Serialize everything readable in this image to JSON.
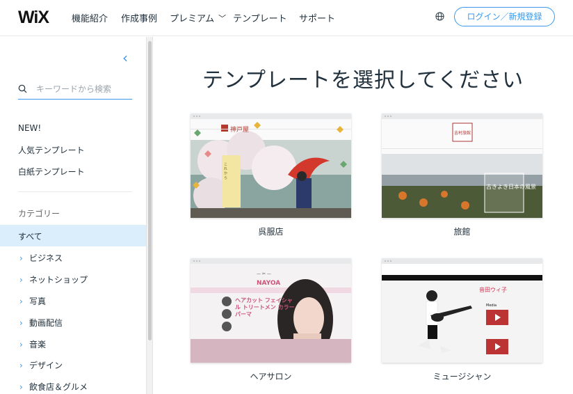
{
  "header": {
    "logo": "WiX",
    "nav": [
      "機能紹介",
      "作成事例",
      "プレミアム",
      "テンプレート",
      "サポート"
    ],
    "login_label": "ログイン／新規登録"
  },
  "sidebar": {
    "search_placeholder": "キーワードから検索",
    "top_items": [
      "NEW!",
      "人気テンプレート",
      "白紙テンプレート"
    ],
    "category_title": "カテゴリー",
    "active_category": "すべて",
    "categories": [
      "ビジネス",
      "ネットショップ",
      "写真",
      "動画配信",
      "音楽",
      "デザイン",
      "飲食店＆グルメ"
    ]
  },
  "main": {
    "title": "テンプレートを選択してください",
    "templates": [
      {
        "label": "呉服店",
        "thumb_text": "神戸屋",
        "thumb_text2": "こ れ か ら"
      },
      {
        "label": "旅館",
        "thumb_text": "吉村旅館",
        "thumb_text2": "古きよき日本の風景"
      },
      {
        "label": "ヘアサロン",
        "thumb_text": "NAYOA",
        "thumb_text2": "ヘアカット フェイシャル トリートメン カラー パーマ"
      },
      {
        "label": "ミュージシャン",
        "thumb_text": "音田ウィ子",
        "thumb_text2": "Media"
      }
    ]
  },
  "colors": {
    "accent": "#3899ec",
    "active_bg": "#dbeefc",
    "text": "#20303c"
  }
}
